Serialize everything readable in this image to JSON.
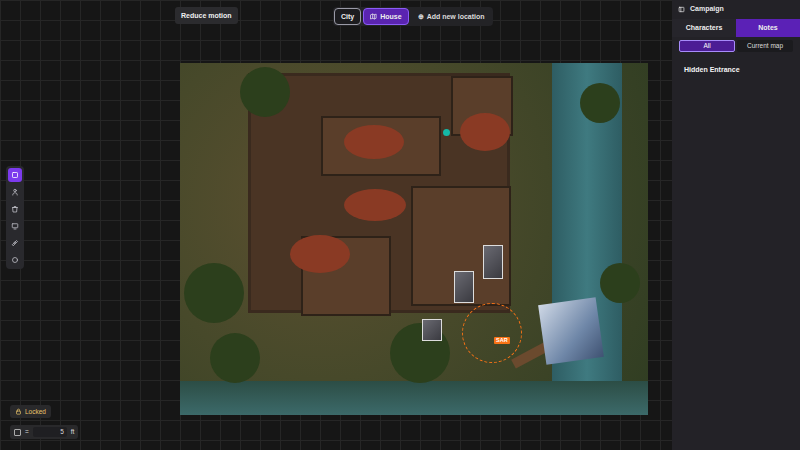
{
  "toolbar": {
    "reduce_motion": "Reduce motion"
  },
  "locations": [
    {
      "label": "City",
      "selected": false
    },
    {
      "label": "House",
      "selected": true
    }
  ],
  "add_location": {
    "icon": "⊕",
    "label": "Add new location"
  },
  "tools": [
    {
      "kind": "select",
      "selected": true
    },
    {
      "kind": "character",
      "selected": false
    },
    {
      "kind": "trash",
      "selected": false
    },
    {
      "kind": "screen",
      "selected": false
    },
    {
      "kind": "ruler",
      "selected": false
    },
    {
      "kind": "circle",
      "selected": false
    }
  ],
  "lock": {
    "label": "Locked",
    "locked": true
  },
  "grid": {
    "equals": "=",
    "size": "5",
    "unit": "ft"
  },
  "map": {
    "tokens": [
      {
        "label": "SAR",
        "selected": true
      }
    ]
  },
  "sidebar": {
    "title": "Campaign",
    "tabs": [
      {
        "label": "Characters",
        "selected": false
      },
      {
        "label": "Notes",
        "selected": true
      }
    ],
    "filters": [
      {
        "label": "All",
        "selected": true
      },
      {
        "label": "Current map",
        "selected": false
      }
    ],
    "notes": [
      "Hidden Entrance"
    ]
  }
}
